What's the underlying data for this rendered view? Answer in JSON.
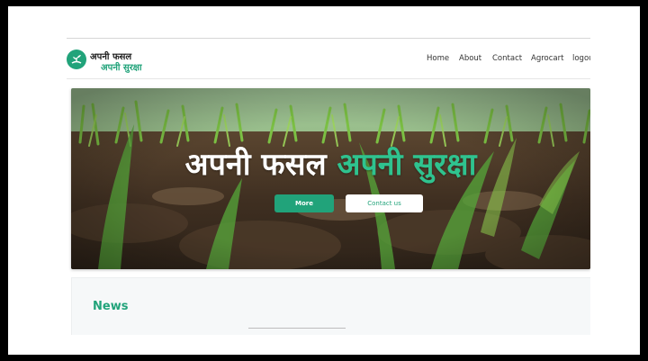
{
  "colors": {
    "accent": "#21a37a",
    "accent_light": "#2fc38f",
    "frame_bg": "#000000"
  },
  "logo": {
    "icon": "sprout-icon",
    "line1": "अपनी फसल",
    "line2": "अपनी सुरक्षा"
  },
  "nav": {
    "items": [
      "Home",
      "About",
      "Contact",
      "Agrocart",
      "logou"
    ]
  },
  "hero": {
    "title_part1": "अपनी फसल",
    "title_part2": "अपनी सुरक्षा",
    "more_label": "More",
    "contact_label": "Contact us"
  },
  "news": {
    "title": "News"
  }
}
